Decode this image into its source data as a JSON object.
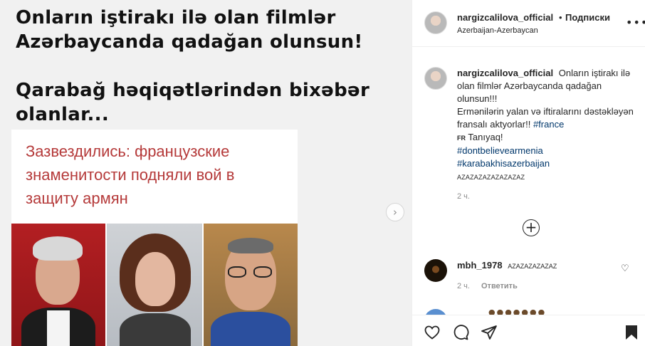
{
  "post_image": {
    "headline_1": [
      "Onların iştirakı ilə olan filmlər",
      "Azərbaycanda qadağan olunsun!"
    ],
    "headline_2": [
      "Qarabağ həqiqətlərindən bixəbər",
      "olanlar..."
    ],
    "news_title": [
      "Зазвездились: французские",
      "знаменитости подняли вой в",
      "защиту армян"
    ],
    "next_icon": "chevron-right-icon"
  },
  "header": {
    "username": "nargizcalilova_official",
    "separator": "•",
    "follow_label": "Подписки",
    "location": "Azerbaijan-Azerbaycan",
    "more_icon": "ellipsis-icon"
  },
  "caption": {
    "username": "nargizcalilova_official",
    "text_1": "Onların iştirakı ilə olan filmlər Azərbaycanda qadağan olunsun!!!",
    "text_2": "Ermənilərin yalan və iftiralarını dəstəkləyən fransalı aktyorlar!!",
    "hashtag_1": "#france",
    "flag": "FR",
    "text_3": "Tanıyaq!",
    "hashtag_2": "#dontbelievearmenia",
    "hashtag_3": "#karabakhisazerbaijan",
    "laugh": "AZAZAZAZAZAZAZAZ",
    "time": "2 ч."
  },
  "load_more_icon": "plus-circle-icon",
  "comment": {
    "username": "mbh_1978",
    "text": "AZAZAZAZAZAZ",
    "time": "2 ч.",
    "reply_label": "Ответить"
  },
  "actions": [
    "heart-icon",
    "comment-icon",
    "share-icon",
    "bookmark-icon"
  ]
}
